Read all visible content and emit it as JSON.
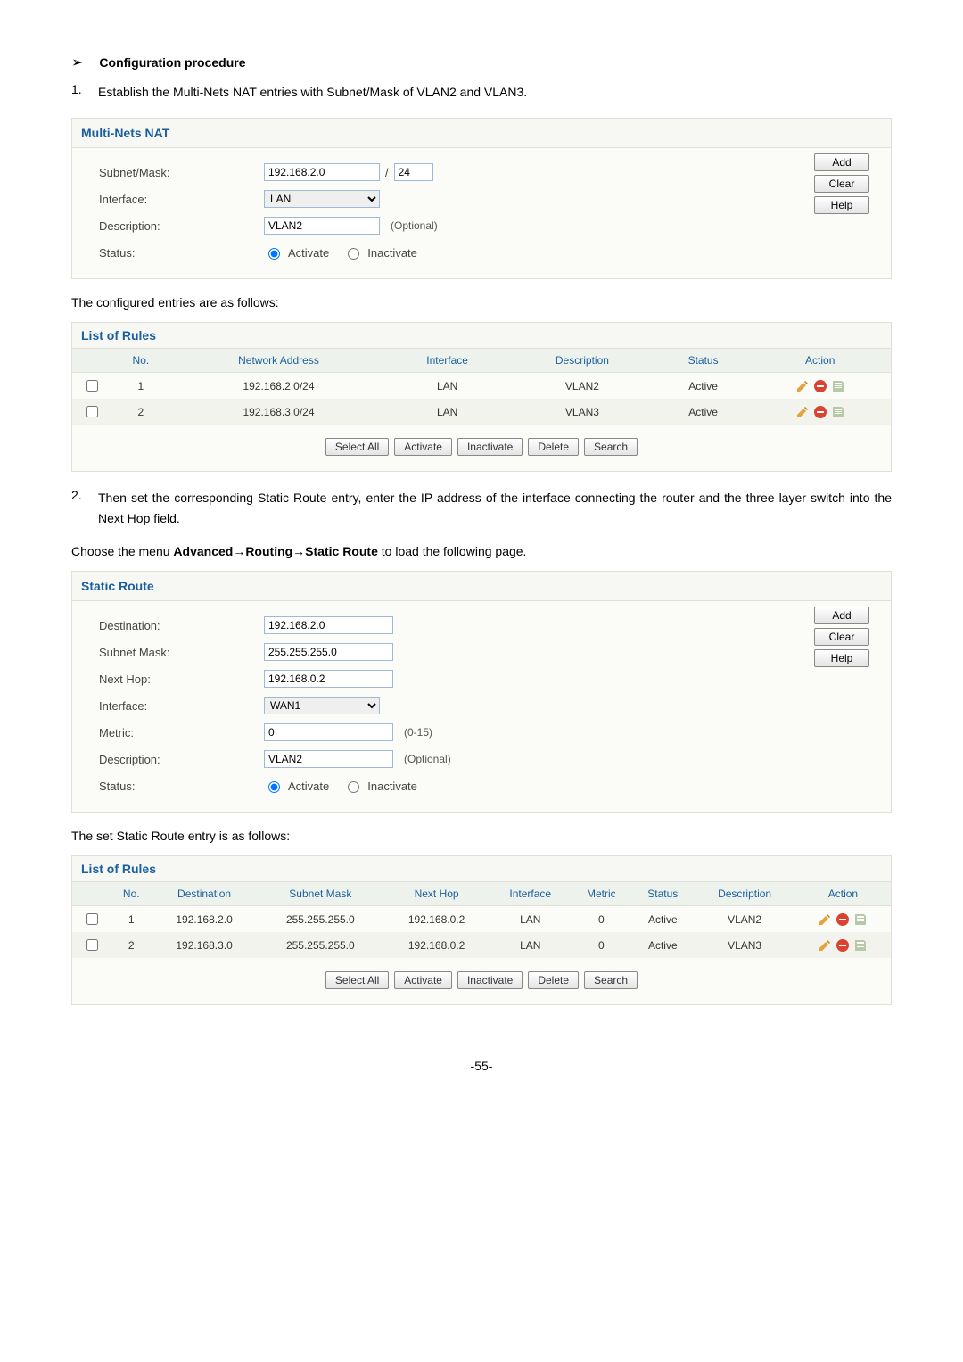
{
  "heading": "Configuration procedure",
  "step1": {
    "num": "1.",
    "text": "Establish the Multi-Nets NAT entries with Subnet/Mask of VLAN2 and VLAN3."
  },
  "multi": {
    "title": "Multi-Nets NAT",
    "subnet_label": "Subnet/Mask:",
    "subnet_value": "192.168.2.0",
    "slash": "/",
    "cidr": "24",
    "interface_label": "Interface:",
    "interface_value": "LAN",
    "desc_label": "Description:",
    "desc_value": "VLAN2",
    "optional": "(Optional)",
    "status_label": "Status:",
    "activate": "Activate",
    "inactivate": "Inactivate",
    "add": "Add",
    "clear": "Clear",
    "help": "Help"
  },
  "configured_text": "The configured entries are as follows:",
  "rules1": {
    "title": "List of Rules",
    "headers": {
      "no": "No.",
      "netaddr": "Network Address",
      "iface": "Interface",
      "desc": "Description",
      "status": "Status",
      "action": "Action"
    },
    "rows": [
      {
        "no": "1",
        "addr": "192.168.2.0/24",
        "iface": "LAN",
        "desc": "VLAN2",
        "status": "Active"
      },
      {
        "no": "2",
        "addr": "192.168.3.0/24",
        "iface": "LAN",
        "desc": "VLAN3",
        "status": "Active"
      }
    ],
    "buttons": {
      "selectall": "Select All",
      "activate": "Activate",
      "inactivate": "Inactivate",
      "delete": "Delete",
      "search": "Search"
    }
  },
  "step2": {
    "num": "2.",
    "text": "Then set the corresponding Static Route entry, enter the IP address of the interface connecting the router and the three layer switch into the Next Hop field."
  },
  "choose_pre": "Choose the menu ",
  "choose_bold": "Advanced→Routing→Static Route",
  "choose_post": " to load the following page.",
  "static": {
    "title": "Static Route",
    "dest_label": "Destination:",
    "dest_value": "192.168.2.0",
    "mask_label": "Subnet Mask:",
    "mask_value": "255.255.255.0",
    "nexthop_label": "Next Hop:",
    "nexthop_value": "192.168.0.2",
    "interface_label": "Interface:",
    "interface_value": "WAN1",
    "metric_label": "Metric:",
    "metric_value": "0",
    "metric_hint": "(0-15)",
    "desc_label": "Description:",
    "desc_value": "VLAN2",
    "optional": "(Optional)",
    "status_label": "Status:",
    "activate": "Activate",
    "inactivate": "Inactivate",
    "add": "Add",
    "clear": "Clear",
    "help": "Help"
  },
  "set_text": "The set Static Route entry is as follows:",
  "rules2": {
    "title": "List of Rules",
    "headers": {
      "no": "No.",
      "dest": "Destination",
      "mask": "Subnet Mask",
      "nexthop": "Next Hop",
      "iface": "Interface",
      "metric": "Metric",
      "status": "Status",
      "desc": "Description",
      "action": "Action"
    },
    "rows": [
      {
        "no": "1",
        "dest": "192.168.2.0",
        "mask": "255.255.255.0",
        "nexthop": "192.168.0.2",
        "iface": "LAN",
        "metric": "0",
        "status": "Active",
        "desc": "VLAN2"
      },
      {
        "no": "2",
        "dest": "192.168.3.0",
        "mask": "255.255.255.0",
        "nexthop": "192.168.0.2",
        "iface": "LAN",
        "metric": "0",
        "status": "Active",
        "desc": "VLAN3"
      }
    ],
    "buttons": {
      "selectall": "Select All",
      "activate": "Activate",
      "inactivate": "Inactivate",
      "delete": "Delete",
      "search": "Search"
    }
  },
  "page_number": "-55-"
}
